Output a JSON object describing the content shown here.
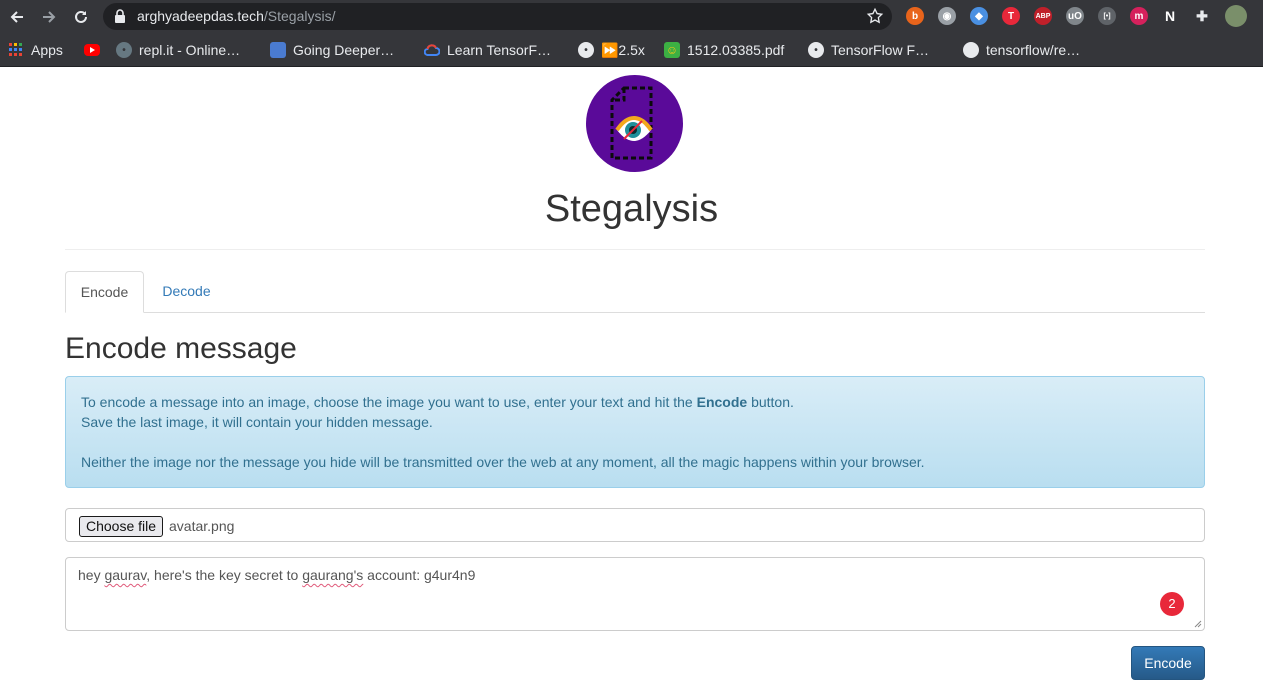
{
  "browser": {
    "url_host": "arghyadeepdas.tech",
    "url_path": "/Stegalysis/",
    "extensions": [
      {
        "name": "brave-icon",
        "color": "#e8641b",
        "glyph": "b"
      },
      {
        "name": "camera-icon",
        "color": "#9aa0a6",
        "glyph": "◉"
      },
      {
        "name": "diamond-icon",
        "color": "#4a90e2",
        "glyph": "◆"
      },
      {
        "name": "t-icon",
        "color": "#e8283a",
        "glyph": "T"
      },
      {
        "name": "adblock-icon",
        "color": "#c0202a",
        "glyph": "ABP"
      },
      {
        "name": "ublock-icon",
        "color": "#80868b",
        "glyph": "uO"
      },
      {
        "name": "code-icon",
        "color": "#5f6368",
        "glyph": "[•]"
      },
      {
        "name": "m-icon",
        "color": "#d5215c",
        "glyph": "m"
      },
      {
        "name": "notion-icon",
        "color": "#ffffff",
        "glyph": "N"
      },
      {
        "name": "puzzle-icon",
        "color": "#e8eaed",
        "glyph": "✚"
      },
      {
        "name": "profile-avatar",
        "color": "#7a8f6a",
        "glyph": ""
      }
    ]
  },
  "bookmarks": [
    {
      "label": "Apps",
      "icon": "apps-grid-icon",
      "color": "#e8eaed"
    },
    {
      "label": "",
      "icon": "youtube-icon",
      "color": "#ff0000"
    },
    {
      "label": "repl.it - Online…",
      "icon": "replit-icon",
      "color": "#667881"
    },
    {
      "label": "Going Deeper…",
      "icon": "going-deeper-icon",
      "color": "#4a7bd0"
    },
    {
      "label": "Learn TensorF…",
      "icon": "google-cloud-icon",
      "color": "#4285f4"
    },
    {
      "label": "⏩2.5x",
      "icon": "globe-icon",
      "color": "#e8eaed"
    },
    {
      "label": "1512.03385.pdf",
      "icon": "smiley-icon",
      "color": "#f5c518"
    },
    {
      "label": "TensorFlow F…",
      "icon": "tensorflow-icon",
      "color": "#e8eaed"
    },
    {
      "label": "tensorflow/re…",
      "icon": "github-icon",
      "color": "#e8eaed"
    }
  ],
  "site": {
    "title": "Stegalysis"
  },
  "tabs": {
    "encode": "Encode",
    "decode": "Decode"
  },
  "section": {
    "heading": "Encode message"
  },
  "alert": {
    "line1_before": "To encode a message into an image, choose the image you want to use, enter your text and hit the ",
    "line1_bold": "Encode",
    "line1_after": " button.",
    "line2": "Save the last image, it will contain your hidden message.",
    "line3": "Neither the image nor the message you hide will be transmitted over the web at any moment, all the magic happens within your browser."
  },
  "file_input": {
    "button_label": "Choose file",
    "file_name": "avatar.png"
  },
  "message": {
    "part1": "hey ",
    "word1": "gaurav",
    "part2": ", here's the key secret to ",
    "word2": "gaurang's",
    "part3": " account: g4ur4n9",
    "badge_count": "2"
  },
  "actions": {
    "encode_label": "Encode"
  }
}
